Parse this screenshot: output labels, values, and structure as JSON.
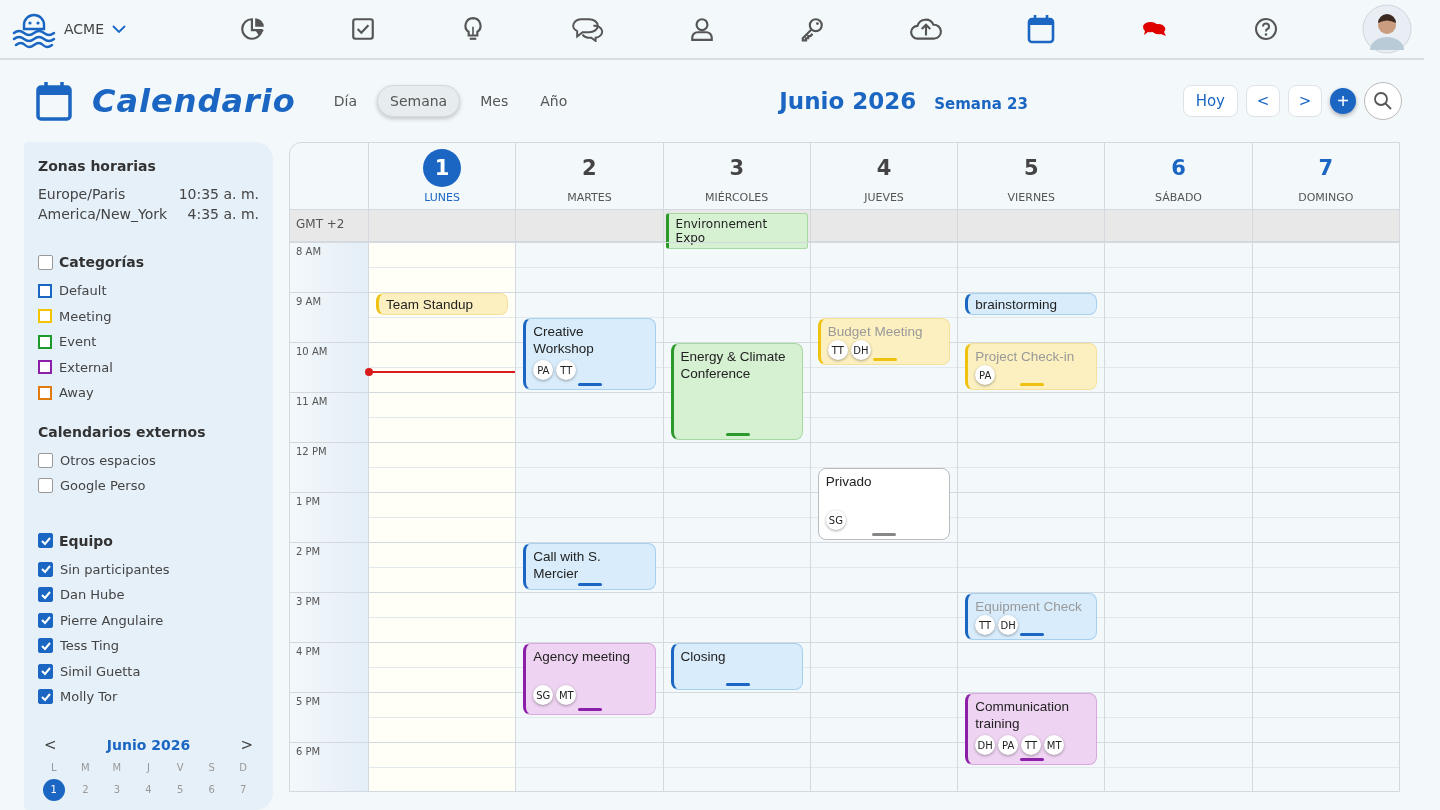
{
  "topbar": {
    "brand": "ACME",
    "nav": [
      {
        "kind": "chart",
        "selected": false
      },
      {
        "kind": "tasks",
        "selected": false
      },
      {
        "kind": "ideas",
        "selected": false
      },
      {
        "kind": "chat",
        "selected": false
      },
      {
        "kind": "user",
        "selected": false
      },
      {
        "kind": "key",
        "selected": false
      },
      {
        "kind": "upload",
        "selected": false
      },
      {
        "kind": "calendar",
        "selected": true
      },
      {
        "kind": "messages",
        "selected": false
      },
      {
        "kind": "help",
        "selected": false
      },
      {
        "kind": "avatar",
        "selected": false
      }
    ]
  },
  "header": {
    "title": "Calendario",
    "views": [
      {
        "label": "Día",
        "selected": false
      },
      {
        "label": "Semana",
        "selected": true
      },
      {
        "label": "Mes",
        "selected": false
      },
      {
        "label": "Año",
        "selected": false
      }
    ],
    "period": "Junio 2026",
    "week": "Semana 23",
    "today_button": "Hoy",
    "prev_button": "<",
    "next_button": ">",
    "add_button": "+"
  },
  "sidebar": {
    "timezones_title": "Zonas horarias",
    "timezones": [
      {
        "zone": "Europe/Paris",
        "time": "10:35 a. m."
      },
      {
        "zone": "America/New_York",
        "time": "4:35 a. m."
      }
    ],
    "groups": [
      {
        "title": "Categorías",
        "checked": false,
        "kind": "colors",
        "items": [
          {
            "label": "Default",
            "color": "#1a66c2"
          },
          {
            "label": "Meeting",
            "color": "#f2c500"
          },
          {
            "label": "Event",
            "color": "#1e9a2a"
          },
          {
            "label": "External",
            "color": "#8b1fa8"
          },
          {
            "label": "Away",
            "color": "#e07b12"
          }
        ]
      },
      {
        "title": "Calendarios externos",
        "kind": "checks",
        "items": [
          {
            "label": "Otros espacios",
            "checked": false
          },
          {
            "label": "Google Perso",
            "checked": false
          }
        ]
      },
      {
        "title": "Equipo",
        "checked": true,
        "kind": "checks",
        "items": [
          {
            "label": "Sin participantes",
            "checked": true
          },
          {
            "label": "Dan Hube",
            "checked": true
          },
          {
            "label": "Pierre Angulaire",
            "checked": true
          },
          {
            "label": "Tess Ting",
            "checked": true
          },
          {
            "label": "Simil Guetta",
            "checked": true
          },
          {
            "label": "Molly Tor",
            "checked": true
          }
        ]
      }
    ],
    "mini_calendar": {
      "month": "Junio 2026",
      "prev": "<",
      "next": ">",
      "weekdays": [
        "L",
        "M",
        "M",
        "J",
        "V",
        "S",
        "D"
      ],
      "days": [
        {
          "label": "1",
          "selected": true
        },
        {
          "label": "2",
          "selected": false
        },
        {
          "label": "3",
          "selected": false
        },
        {
          "label": "4",
          "selected": false
        },
        {
          "label": "5",
          "selected": false
        },
        {
          "label": "6",
          "selected": false
        },
        {
          "label": "7",
          "selected": false
        }
      ]
    }
  },
  "calendar": {
    "timezone_label": "GMT +2",
    "hours": [
      "8 AM",
      "9 AM",
      "10 AM",
      "11 AM",
      "12 PM",
      "1 PM",
      "2 PM",
      "3 PM",
      "4 PM",
      "5 PM",
      "6 PM"
    ],
    "days": [
      {
        "number": "1",
        "weekday": "LUNES",
        "selected": true,
        "weekend": false,
        "events": [
          {
            "title": "Team Standup",
            "kind": "meeting",
            "tentative": false
          }
        ]
      },
      {
        "number": "2",
        "weekday": "MARTES",
        "selected": false,
        "weekend": false,
        "events": [
          {
            "title": "Creative Workshop",
            "kind": "default",
            "tentative": false,
            "people": [
              "PA",
              "TT"
            ]
          },
          {
            "title": "Call with S. Mercier",
            "kind": "default",
            "tentative": false
          },
          {
            "title": "Agency meeting",
            "kind": "external",
            "tentative": false,
            "people": [
              "SG",
              "MT"
            ]
          }
        ]
      },
      {
        "number": "3",
        "weekday": "MIÉRCOLES",
        "selected": false,
        "weekend": false,
        "all_day": [
          {
            "title": "Environnement Expo",
            "kind": "event"
          }
        ],
        "events": [
          {
            "title": "Energy & Climate Conference",
            "kind": "event",
            "tentative": false
          },
          {
            "title": "Closing",
            "kind": "default",
            "tentative": false
          }
        ]
      },
      {
        "number": "4",
        "weekday": "JUEVES",
        "selected": false,
        "weekend": false,
        "events": [
          {
            "title": "Budget Meeting",
            "kind": "meeting",
            "tentative": true,
            "people": [
              "TT",
              "DH"
            ]
          },
          {
            "title": "Privado",
            "kind": "private",
            "tentative": false,
            "people": [
              "SG"
            ]
          }
        ]
      },
      {
        "number": "5",
        "weekday": "VIERNES",
        "selected": false,
        "weekend": false,
        "events": [
          {
            "title": "brainstorming",
            "kind": "default",
            "tentative": false
          },
          {
            "title": "Project Check-in",
            "kind": "meeting",
            "tentative": true,
            "people": [
              "PA"
            ]
          },
          {
            "title": "Equipment Check",
            "kind": "default",
            "tentative": true,
            "people": [
              "TT",
              "DH"
            ]
          },
          {
            "title": "Communication training",
            "kind": "external",
            "tentative": false,
            "people": [
              "DH",
              "PA",
              "TT",
              "MT"
            ]
          }
        ]
      },
      {
        "number": "6",
        "weekday": "SÁBADO",
        "selected": false,
        "weekend": true
      },
      {
        "number": "7",
        "weekday": "DOMINGO",
        "selected": false,
        "weekend": true
      }
    ]
  }
}
